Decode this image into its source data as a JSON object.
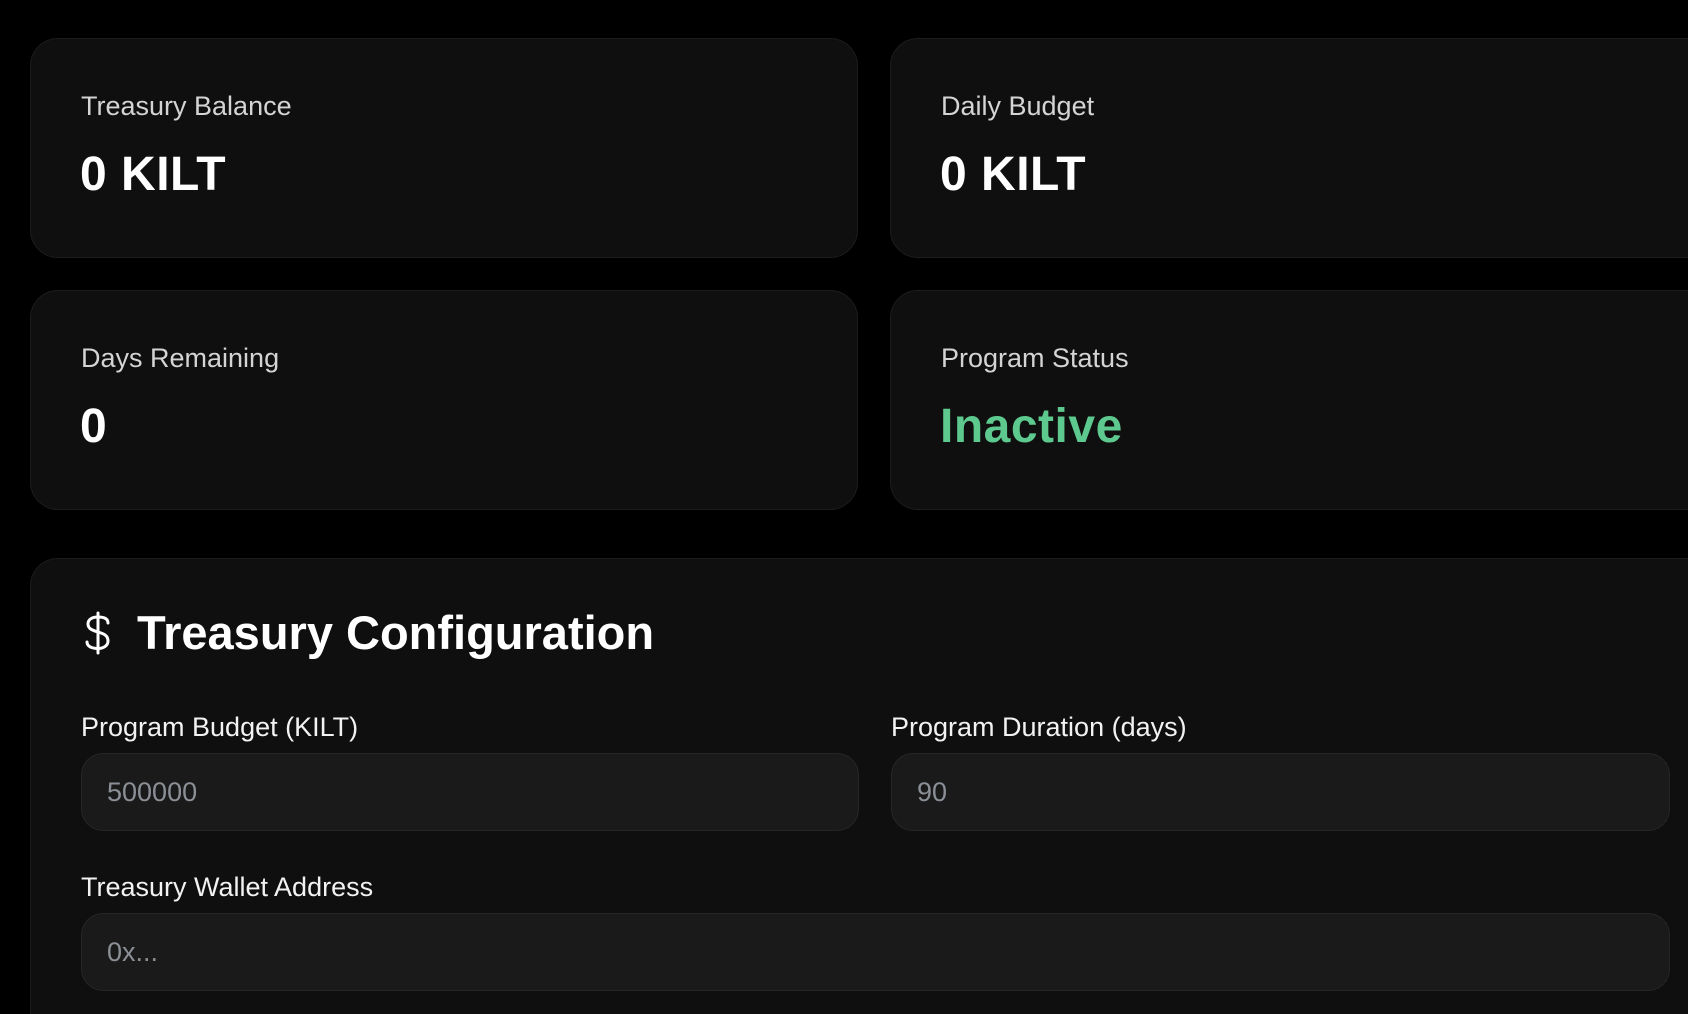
{
  "stats": [
    {
      "label": "Treasury Balance",
      "value": "0 KILT"
    },
    {
      "label": "Daily Budget",
      "value": "0 KILT"
    },
    {
      "label": "Days Remaining",
      "value": "0"
    },
    {
      "label": "Program Status",
      "value": "Inactive"
    }
  ],
  "config": {
    "icon": "dollar-icon",
    "title": "Treasury Configuration",
    "fields": {
      "budget": {
        "label": "Program Budget (KILT)",
        "placeholder": "500000",
        "value": ""
      },
      "duration": {
        "label": "Program Duration (days)",
        "placeholder": "90",
        "value": ""
      },
      "wallet": {
        "label": "Treasury Wallet Address",
        "placeholder": "0x...",
        "value": ""
      }
    }
  },
  "colors": {
    "background": "#000000",
    "card": "#0f0f0f",
    "input": "#1a1a1a",
    "status_inactive": "#5dc98e"
  }
}
